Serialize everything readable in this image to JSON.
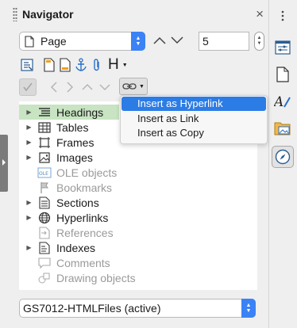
{
  "navigator": {
    "title": "Navigator",
    "close_glyph": "×",
    "category_select": {
      "value": "Page"
    },
    "page_number": "5",
    "heading_button_label": "H",
    "tree_items": [
      {
        "label": "Headings",
        "expandable": true,
        "dimmed": false,
        "icon": "headings-icon",
        "selected": true
      },
      {
        "label": "Tables",
        "expandable": true,
        "dimmed": false,
        "icon": "table-icon"
      },
      {
        "label": "Frames",
        "expandable": true,
        "dimmed": false,
        "icon": "frame-icon"
      },
      {
        "label": "Images",
        "expandable": true,
        "dimmed": false,
        "icon": "image-icon"
      },
      {
        "label": "OLE objects",
        "expandable": false,
        "dimmed": true,
        "icon": "ole-icon"
      },
      {
        "label": "Bookmarks",
        "expandable": false,
        "dimmed": true,
        "icon": "bookmark-icon"
      },
      {
        "label": "Sections",
        "expandable": true,
        "dimmed": false,
        "icon": "section-icon"
      },
      {
        "label": "Hyperlinks",
        "expandable": true,
        "dimmed": false,
        "icon": "globe-icon"
      },
      {
        "label": "References",
        "expandable": false,
        "dimmed": true,
        "icon": "reference-icon"
      },
      {
        "label": "Indexes",
        "expandable": true,
        "dimmed": false,
        "icon": "index-icon"
      },
      {
        "label": "Comments",
        "expandable": false,
        "dimmed": true,
        "icon": "comment-icon"
      },
      {
        "label": "Drawing objects",
        "expandable": false,
        "dimmed": true,
        "icon": "drawing-icon"
      }
    ],
    "document_select": {
      "value": "GS7012-HTMLFiles (active)"
    }
  },
  "drag_mode_menu": {
    "items": [
      {
        "label": "Insert as Hyperlink",
        "highlighted": true
      },
      {
        "label": "Insert as Link",
        "highlighted": false
      },
      {
        "label": "Insert as Copy",
        "highlighted": false
      }
    ]
  },
  "colors": {
    "accent": "#3b82f6",
    "selection_green": "#c8e4c2",
    "menu_highlight": "#2c7ce5"
  }
}
